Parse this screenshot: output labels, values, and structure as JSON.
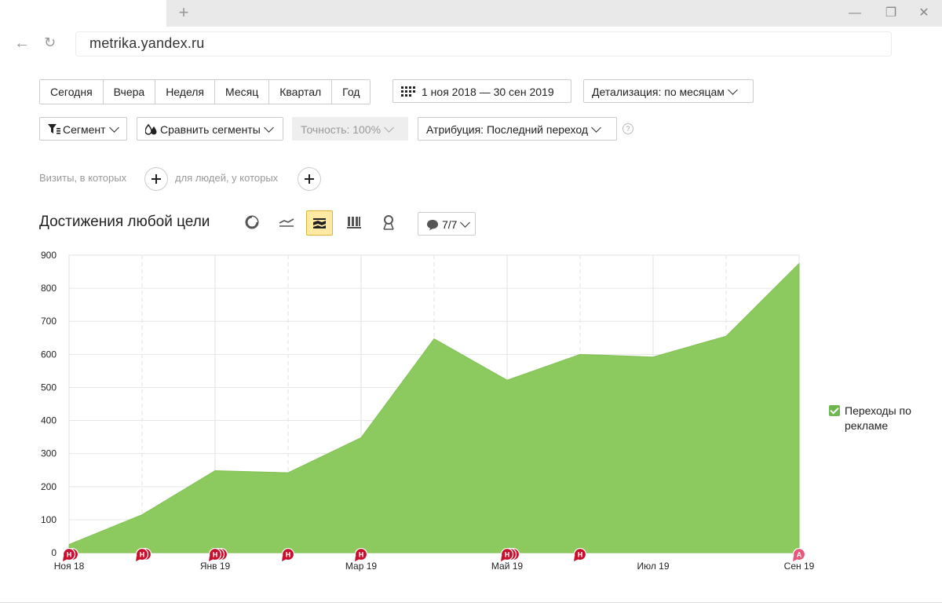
{
  "browser": {
    "url": "metrika.yandex.ru",
    "new_tab": "+"
  },
  "toolbar": {
    "periods": [
      "Сегодня",
      "Вчера",
      "Неделя",
      "Месяц",
      "Квартал",
      "Год"
    ],
    "date_range": "1 ноя 2018 — 30 сен 2019",
    "detail": "Детализация: по месяцам",
    "segment": "Сегмент",
    "compare": "Сравнить сегменты",
    "accuracy": "Точность: 100%",
    "attribution": "Атрибуция: Последний переход",
    "help": "?"
  },
  "filters": {
    "visits_label": "Визиты, в которых",
    "people_label": "для людей, у которых"
  },
  "chart_header": {
    "title": "Достижения любой цели",
    "notes_count": "7/7"
  },
  "legend": {
    "series_label": "Переходы по рекламе",
    "color": "#8cc95f"
  },
  "chart_data": {
    "type": "area",
    "title": "Достижения любой цели",
    "x": [
      "2018-11",
      "2018-12",
      "2019-01",
      "2019-02",
      "2019-03",
      "2019-04",
      "2019-05",
      "2019-06",
      "2019-07",
      "2019-08",
      "2019-09"
    ],
    "xtick_labels": [
      "Ноя 18",
      "Янв 19",
      "Мар 19",
      "Май 19",
      "Июл 19",
      "Сен 19"
    ],
    "xtick_months": [
      "2018-11",
      "2019-01",
      "2019-03",
      "2019-05",
      "2019-07",
      "2019-09"
    ],
    "ylim": [
      0,
      900
    ],
    "yticks": [
      0,
      100,
      200,
      300,
      400,
      500,
      600,
      700,
      800,
      900
    ],
    "grid": true,
    "series": [
      {
        "name": "Переходы по рекламе",
        "color": "#8cc95f",
        "values": [
          25,
          115,
          248,
          242,
          348,
          647,
          522,
          600,
          592,
          655,
          875
        ]
      }
    ],
    "annotations": [
      {
        "month": "2018-11",
        "label": "Н",
        "count": 2,
        "color": "#c8102e"
      },
      {
        "month": "2018-12",
        "label": "Н",
        "count": 2,
        "color": "#c8102e"
      },
      {
        "month": "2019-01",
        "label": "Н",
        "count": 3,
        "color": "#c8102e"
      },
      {
        "month": "2019-02",
        "label": "Н",
        "count": 1,
        "color": "#c8102e"
      },
      {
        "month": "2019-03",
        "label": "Н",
        "count": 1,
        "color": "#c8102e"
      },
      {
        "month": "2019-05",
        "label": "Н",
        "count": 3,
        "color": "#c8102e"
      },
      {
        "month": "2019-06",
        "label": "Н",
        "count": 1,
        "color": "#c8102e"
      },
      {
        "month": "2019-09",
        "label": "А",
        "count": 1,
        "color": "#e8567a"
      }
    ]
  }
}
